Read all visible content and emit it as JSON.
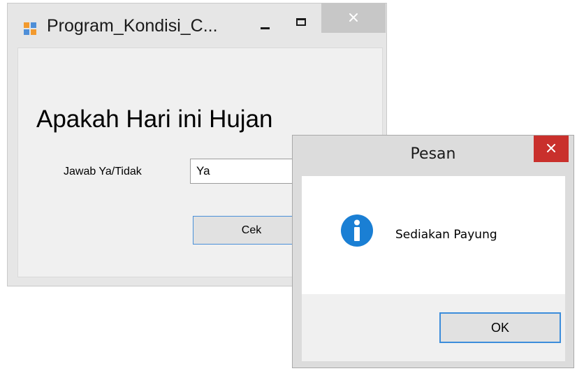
{
  "main_window": {
    "title": "Program_Kondisi_C...",
    "icon": "app-window-icon",
    "controls": {
      "minimize": "minimize-icon",
      "maximize": "maximize-icon",
      "close": "close-icon"
    },
    "heading": "Apakah Hari ini Hujan",
    "answer_label": "Jawab Ya/Tidak",
    "answer_value": "Ya",
    "check_button": "Cek"
  },
  "message_box": {
    "title": "Pesan",
    "close_icon": "close-icon",
    "icon": "info-icon",
    "message": "Sediakan Payung",
    "ok_button": "OK"
  },
  "colors": {
    "close_button_active": "#c9302c",
    "info_icon": "#1a7fd4",
    "button_focus_border": "#3c8ddb"
  }
}
